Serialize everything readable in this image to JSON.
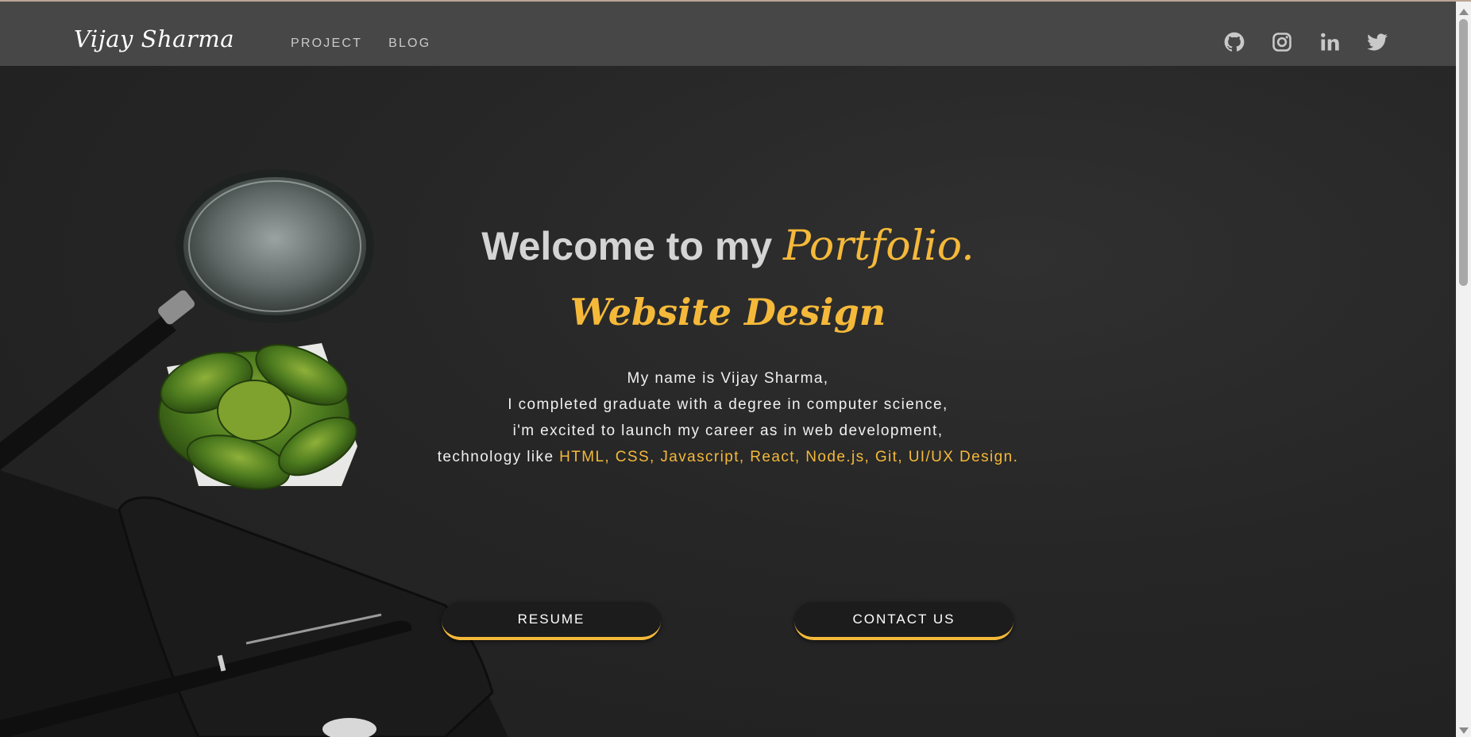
{
  "navbar": {
    "brand": "Vijay Sharma",
    "links": [
      {
        "label": "PROJECT"
      },
      {
        "label": "BLOG"
      }
    ],
    "socials": [
      "github-icon",
      "instagram-icon",
      "linkedin-icon",
      "twitter-icon"
    ]
  },
  "hero": {
    "welcome_prefix": "Welcome to my ",
    "welcome_script": "Portfolio.",
    "subtitle": "Website Design",
    "bio_lines": [
      "My name is Vijay Sharma,",
      "I completed graduate with a degree in computer science,",
      "i'm excited to launch my career as in web development,"
    ],
    "tech_prefix": "technology like ",
    "tech_list": "HTML, CSS, Javascript, React, Node.js, Git, UI/UX Design."
  },
  "buttons": {
    "resume": "RESUME",
    "contact": "CONTACT US"
  },
  "colors": {
    "accent": "#f5b93a",
    "navbar": "#474747",
    "background": "#232323"
  }
}
